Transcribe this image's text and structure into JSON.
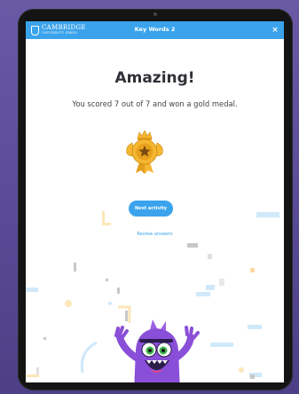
{
  "header": {
    "brand_name": "CAMBRIDGE",
    "brand_subtitle": "UNIVERSITY PRESS",
    "title": "Key Words 2",
    "close_symbol": "×"
  },
  "result": {
    "headline": "Amazing!",
    "message": "You scored 7 out of 7 and won a gold medal.",
    "medal": "gold-medal-icon"
  },
  "actions": {
    "next_label": "Next activity",
    "review_label": "Review answers"
  },
  "colors": {
    "accent": "#3aa3ec",
    "background": "#5b4b98",
    "medal_gold": "#f5b731",
    "monster_purple": "#8a4fd8"
  }
}
